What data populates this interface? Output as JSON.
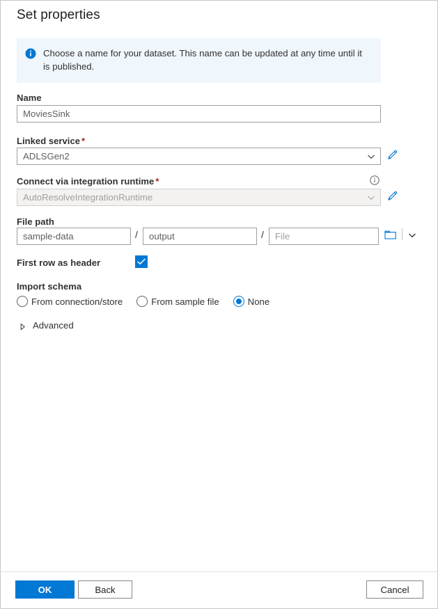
{
  "dialog": {
    "title": "Set properties"
  },
  "info_banner": {
    "icon": "info-filled-icon",
    "text": "Choose a name for your dataset. This name can be updated at any time until it is published."
  },
  "fields": {
    "name": {
      "label": "Name",
      "value": "MoviesSink"
    },
    "linked_service": {
      "label": "Linked service",
      "required_marker": "*",
      "value": "ADLSGen2",
      "edit_icon": "pencil-icon",
      "dropdown_icon": "chevron-down-icon"
    },
    "integration_runtime": {
      "label": "Connect via integration runtime",
      "required_marker": "*",
      "value": "AutoResolveIntegrationRuntime",
      "disabled": true,
      "info_icon": "info-outline-icon",
      "edit_icon": "pencil-icon",
      "dropdown_icon": "chevron-down-icon"
    },
    "file_path": {
      "label": "File path",
      "container_value": "sample-data",
      "directory_value": "output",
      "file_placeholder": "File",
      "separator": "/",
      "browse_icon": "folder-icon",
      "dropdown_icon": "chevron-down-icon"
    },
    "first_row_as_header": {
      "label": "First row as header",
      "checked": true,
      "check_icon": "checkmark-icon"
    },
    "import_schema": {
      "label": "Import schema",
      "options": [
        {
          "label": "From connection/store",
          "selected": false
        },
        {
          "label": "From sample file",
          "selected": false
        },
        {
          "label": "None",
          "selected": true
        }
      ]
    },
    "advanced": {
      "label": "Advanced",
      "expanded": false,
      "caret_icon": "caret-right-icon"
    }
  },
  "footer": {
    "ok_label": "OK",
    "back_label": "Back",
    "cancel_label": "Cancel"
  },
  "colors": {
    "accent": "#0078D4",
    "banner_bg": "#EFF6FC",
    "required_star": "#A4262C",
    "text_primary": "#323130",
    "text_secondary": "#605E5C",
    "disabled_bg": "#F3F2F1"
  }
}
